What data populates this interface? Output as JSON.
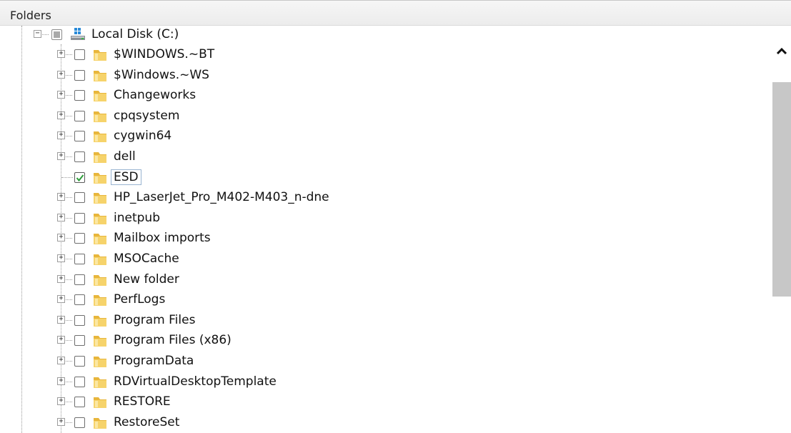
{
  "header": {
    "title": "Folders"
  },
  "root": {
    "label": "Local Disk (C:)",
    "icon": "drive-icon",
    "check_state": "partial"
  },
  "folders": [
    {
      "label": "$WINDOWS.~BT",
      "check_state": "unchecked",
      "has_children": true
    },
    {
      "label": "$Windows.~WS",
      "check_state": "unchecked",
      "has_children": true
    },
    {
      "label": "Changeworks",
      "check_state": "unchecked",
      "has_children": true
    },
    {
      "label": "cpqsystem",
      "check_state": "unchecked",
      "has_children": true
    },
    {
      "label": "cygwin64",
      "check_state": "unchecked",
      "has_children": true
    },
    {
      "label": "dell",
      "check_state": "unchecked",
      "has_children": true
    },
    {
      "label": "ESD",
      "check_state": "checked",
      "has_children": false,
      "selected": true
    },
    {
      "label": "HP_LaserJet_Pro_M402-M403_n-dne",
      "check_state": "unchecked",
      "has_children": true
    },
    {
      "label": "inetpub",
      "check_state": "unchecked",
      "has_children": true
    },
    {
      "label": "Mailbox imports",
      "check_state": "unchecked",
      "has_children": true
    },
    {
      "label": "MSOCache",
      "check_state": "unchecked",
      "has_children": true
    },
    {
      "label": "New folder",
      "check_state": "unchecked",
      "has_children": true
    },
    {
      "label": "PerfLogs",
      "check_state": "unchecked",
      "has_children": true
    },
    {
      "label": "Program Files",
      "check_state": "unchecked",
      "has_children": true
    },
    {
      "label": "Program Files (x86)",
      "check_state": "unchecked",
      "has_children": true
    },
    {
      "label": "ProgramData",
      "check_state": "unchecked",
      "has_children": true
    },
    {
      "label": "RDVirtualDesktopTemplate",
      "check_state": "unchecked",
      "has_children": true
    },
    {
      "label": "RESTORE",
      "check_state": "unchecked",
      "has_children": true
    },
    {
      "label": "RestoreSet",
      "check_state": "unchecked",
      "has_children": true
    }
  ],
  "scrollbar": {
    "up_icon": "chevron-up-icon"
  },
  "colors": {
    "folder_yellow": "#f2c94c",
    "check_green": "#2e9e3a",
    "selection_border": "#99b4d1"
  }
}
